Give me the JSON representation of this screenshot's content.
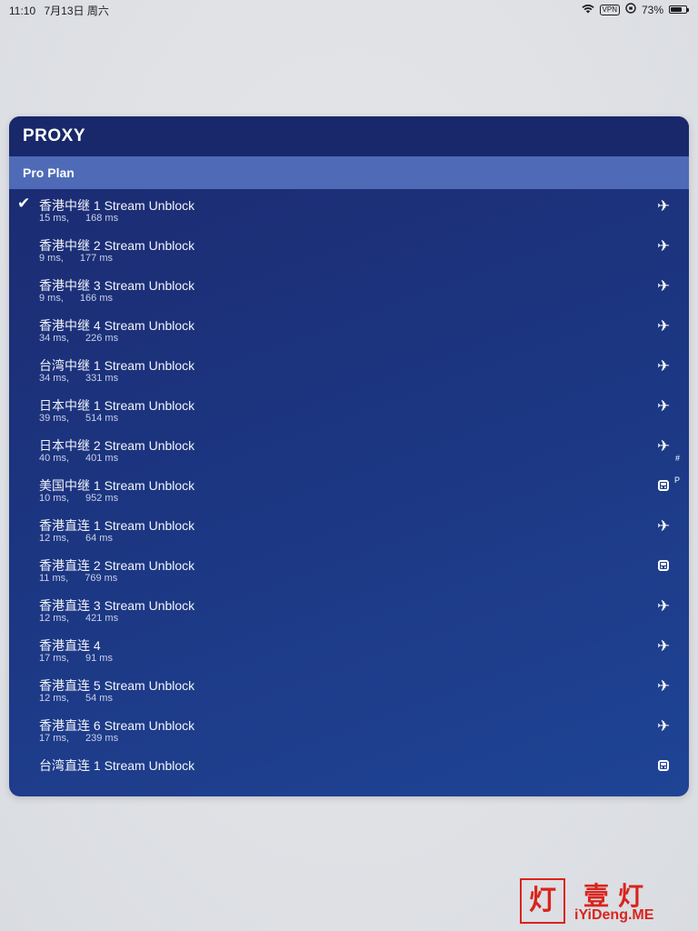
{
  "status_bar": {
    "time": "11:10",
    "date": "7月13日 周六",
    "vpn": "VPN",
    "battery_percent": "73%",
    "battery_level": 0.73
  },
  "panel": {
    "title": "PROXY",
    "group": "Pro Plan",
    "rows": [
      {
        "name": "香港中继 1 Stream Unblock",
        "latency1": "15 ms,",
        "latency2": "168 ms",
        "selected": true,
        "icon": "airplane-icon"
      },
      {
        "name": "香港中继 2 Stream Unblock",
        "latency1": "9 ms,",
        "latency2": "177 ms",
        "selected": false,
        "icon": "airplane-icon"
      },
      {
        "name": "香港中继 3 Stream Unblock",
        "latency1": "9 ms,",
        "latency2": "166 ms",
        "selected": false,
        "icon": "airplane-icon"
      },
      {
        "name": "香港中继 4 Stream Unblock",
        "latency1": "34 ms,",
        "latency2": "226 ms",
        "selected": false,
        "icon": "airplane-icon"
      },
      {
        "name": "台湾中继 1 Stream Unblock",
        "latency1": "34 ms,",
        "latency2": "331 ms",
        "selected": false,
        "icon": "airplane-icon"
      },
      {
        "name": "日本中继 1 Stream Unblock",
        "latency1": "39 ms,",
        "latency2": "514 ms",
        "selected": false,
        "icon": "airplane-icon"
      },
      {
        "name": "日本中继 2 Stream Unblock",
        "latency1": "40 ms,",
        "latency2": "401 ms",
        "selected": false,
        "icon": "airplane-icon",
        "sup": "#"
      },
      {
        "name": "美国中继 1 Stream Unblock",
        "latency1": "10 ms,",
        "latency2": "952 ms",
        "selected": false,
        "icon": "bus-icon",
        "sup": "P"
      },
      {
        "name": "香港直连 1 Stream Unblock",
        "latency1": "12 ms,",
        "latency2": "64 ms",
        "selected": false,
        "icon": "airplane-icon"
      },
      {
        "name": "香港直连 2 Stream Unblock",
        "latency1": "11 ms,",
        "latency2": "769 ms",
        "selected": false,
        "icon": "bus-icon"
      },
      {
        "name": "香港直连 3 Stream Unblock",
        "latency1": "12 ms,",
        "latency2": "421 ms",
        "selected": false,
        "icon": "airplane-icon"
      },
      {
        "name": "香港直连 4",
        "latency1": "17 ms,",
        "latency2": "91 ms",
        "selected": false,
        "icon": "airplane-icon"
      },
      {
        "name": "香港直连 5 Stream Unblock",
        "latency1": "12 ms,",
        "latency2": "54 ms",
        "selected": false,
        "icon": "airplane-icon"
      },
      {
        "name": "香港直连 6 Stream Unblock",
        "latency1": "17 ms,",
        "latency2": "239 ms",
        "selected": false,
        "icon": "airplane-icon"
      },
      {
        "name": "台湾直连 1 Stream Unblock",
        "latency1": "",
        "latency2": "",
        "selected": false,
        "icon": "bus-icon"
      }
    ]
  },
  "watermark": {
    "logo_char": "灯",
    "title": "壹灯",
    "url": "iYiDeng.ME"
  },
  "colors": {
    "panel_bg": "#1c3580",
    "header_bg": "#18286a",
    "group_bg": "#4f6bb7",
    "watermark": "#d9241c"
  }
}
